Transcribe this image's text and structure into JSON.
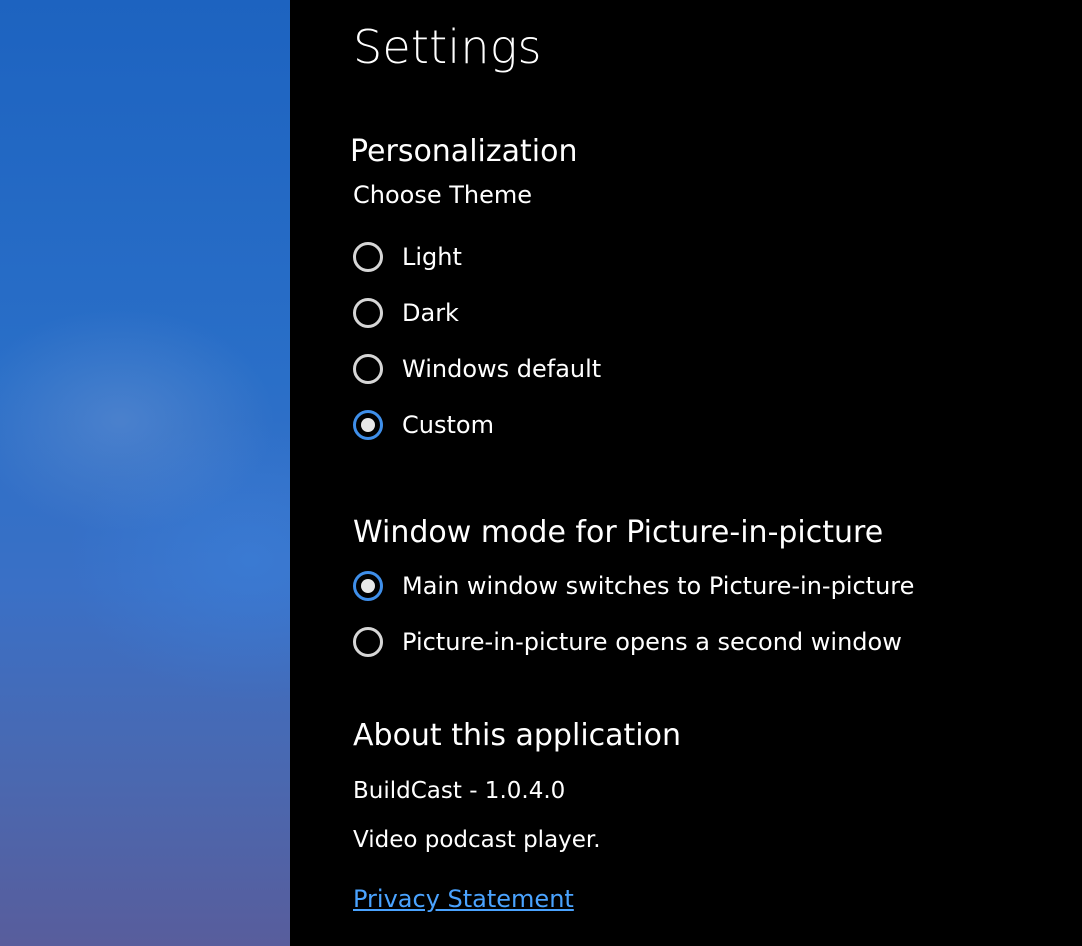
{
  "settings": {
    "title": "Settings",
    "personalization": {
      "heading": "Personalization",
      "theme_label": "Choose Theme",
      "options": [
        {
          "label": "Light",
          "checked": false
        },
        {
          "label": "Dark",
          "checked": false
        },
        {
          "label": "Windows default",
          "checked": false
        },
        {
          "label": "Custom",
          "checked": true
        }
      ]
    },
    "pip": {
      "heading": "Window mode for Picture-in-picture",
      "options": [
        {
          "label": "Main window switches to Picture-in-picture",
          "checked": true
        },
        {
          "label": "Picture-in-picture opens a second window",
          "checked": false
        }
      ]
    },
    "about": {
      "heading": "About this application",
      "version": "BuildCast - 1.0.4.0",
      "description": "Video podcast player.",
      "privacy_link": "Privacy Statement"
    }
  },
  "colors": {
    "accent": "#3f8fea",
    "link": "#4aa3ff",
    "background": "#000000"
  }
}
